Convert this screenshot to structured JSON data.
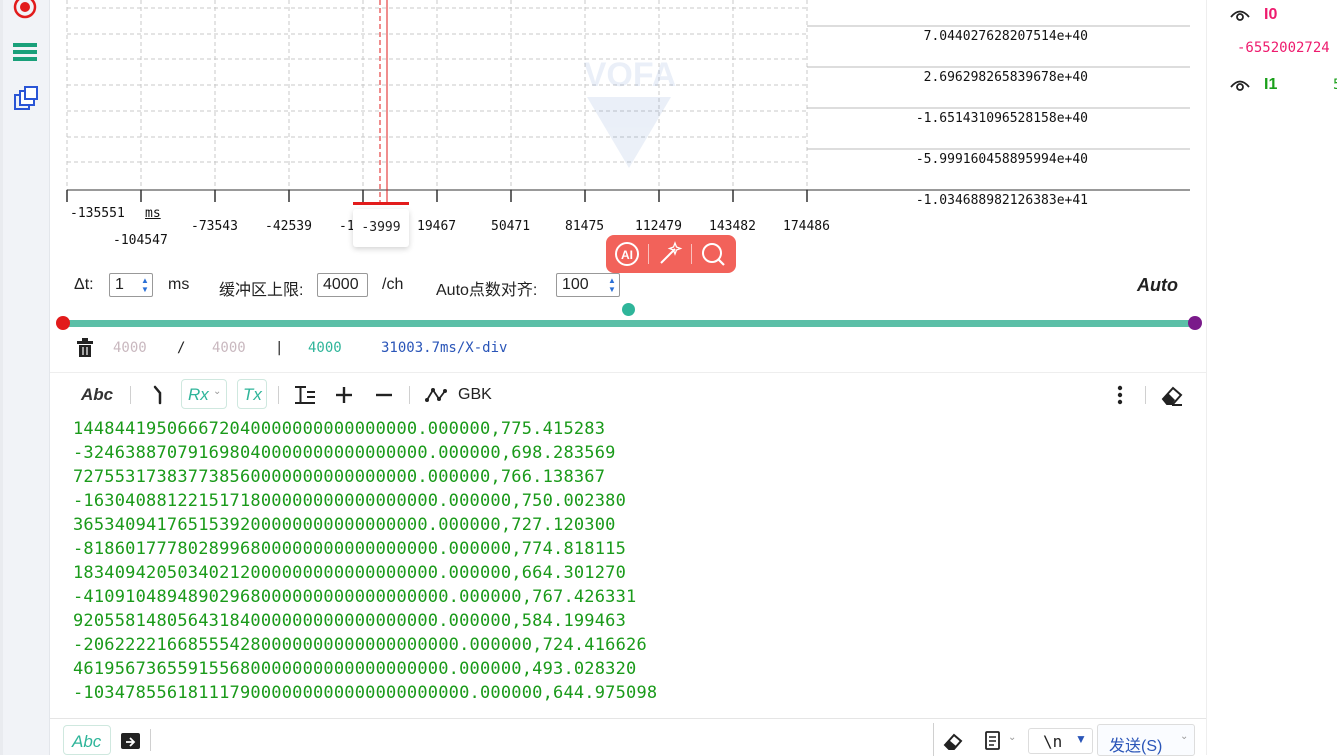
{
  "plot": {
    "x_ticks": [
      "-135551",
      "-104547",
      "-73543",
      "-42539",
      "-1",
      "19467",
      "50471",
      "81475",
      "112479",
      "143482",
      "174486"
    ],
    "x_unit": "ms",
    "cursor_label": "-3999",
    "y_ticks": [
      "7.044027628207514e+40",
      "2.696298265839678e+40",
      "-1.651431096528158e+40",
      "-5.999160458895994e+40",
      "-1.034688982126383e+41"
    ],
    "watermark": "VOFA"
  },
  "channels": [
    {
      "name": "I0",
      "value": "-6552002724",
      "color": "#ee1b6e"
    },
    {
      "name": "I1",
      "value": "5",
      "color": "#1aa01a"
    }
  ],
  "controls": {
    "dt_label": "Δt:",
    "dt_value": "1",
    "dt_unit": "ms",
    "buffer_label": "缓冲区上限:",
    "buffer_value": "4000",
    "buffer_unit": "/ch",
    "auto_label": "Auto点数对齐:",
    "auto_value": "100",
    "auto_button": "Auto"
  },
  "stats": {
    "a": "4000",
    "sep1": "/",
    "b": "4000",
    "sep2": "|",
    "c": "4000",
    "xdiv": "31003.7ms/X-div"
  },
  "toolbar": {
    "abc": "Abc",
    "rx": "Rx",
    "tx": "Tx",
    "encoding": "GBK"
  },
  "log_lines": [
    "144844195066672040000000000000000.000000,775.415283",
    "-324638870791698040000000000000000.000000,698.283569",
    "727553173837738560000000000000000.000000,766.138367",
    "-1630408812215171800000000000000000.000000,750.002380",
    "3653409417651539200000000000000000.000000,727.120300",
    "-8186017778028996800000000000000000.000000,774.818115",
    "18340942050340212000000000000000000.000000,664.301270",
    "-41091048948902968000000000000000000.000000,767.426331",
    "92055814805643184000000000000000000.000000,584.199463",
    "-206222216685554280000000000000000000.000000,724.416626",
    "461956736559155680000000000000000000.000000,493.028320",
    "-1034785561811179000000000000000000000.000000,644.975098"
  ],
  "bottom": {
    "abc": "Abc",
    "newline": "\\n",
    "send": "发送(S)"
  },
  "colors": {
    "accent_teal": "#5bbfa7",
    "log_green": "#1a9a1a",
    "red": "#e21b1b",
    "purple": "#7a1a8a"
  }
}
